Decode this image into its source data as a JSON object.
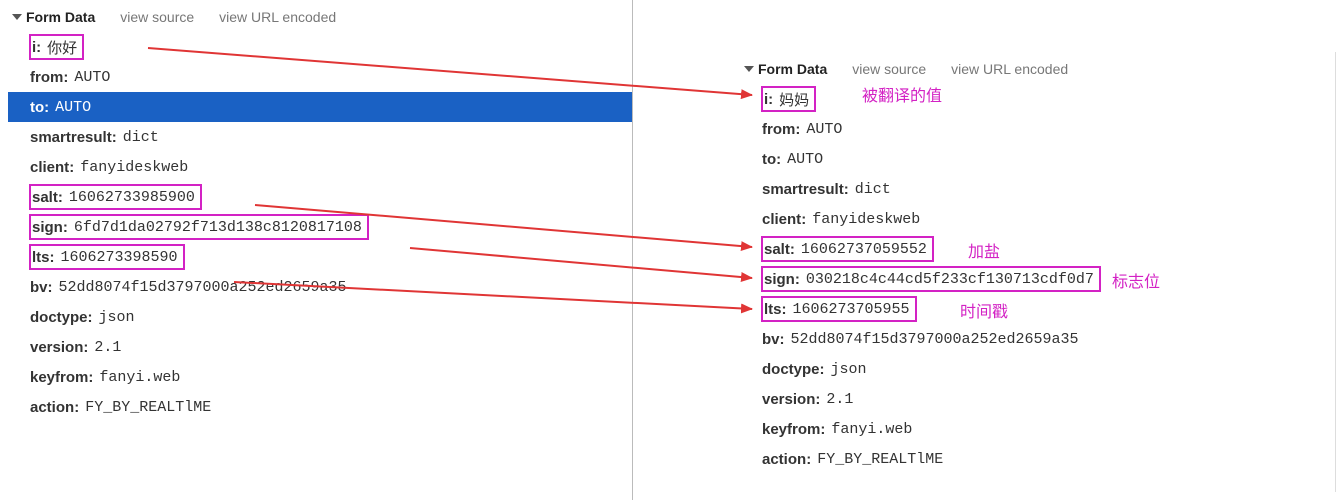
{
  "left": {
    "header": {
      "title": "Form Data",
      "tab_source": "view source",
      "tab_url": "view URL encoded"
    },
    "rows": {
      "i": "你好",
      "from": "AUTO",
      "to": "AUTO",
      "smartresult": "dict",
      "client": "fanyideskweb",
      "salt": "16062733985900",
      "sign": "6fd7d1da02792f713d138c8120817108",
      "lts": "1606273398590",
      "bv": "52dd8074f15d3797000a252ed2659a35",
      "doctype": "json",
      "version": "2.1",
      "keyfrom": "fanyi.web",
      "action": "FY_BY_REALTlME"
    }
  },
  "right": {
    "header": {
      "title": "Form Data",
      "tab_source": "view source",
      "tab_url": "view URL encoded"
    },
    "rows": {
      "i": "妈妈",
      "from": "AUTO",
      "to": "AUTO",
      "smartresult": "dict",
      "client": "fanyideskweb",
      "salt": "16062737059552",
      "sign": "030218c4c44cd5f233cf130713cdf0d7",
      "lts": "1606273705955",
      "bv": "52dd8074f15d3797000a252ed2659a35",
      "doctype": "json",
      "version": "2.1",
      "keyfrom": "fanyi.web",
      "action": "FY_BY_REALTlME"
    }
  },
  "annotations": {
    "a1": "被翻译的值",
    "a2": "加盐",
    "a3": "标志位",
    "a4": "时间戳"
  },
  "labels": {
    "i": "i",
    "from": "from",
    "to": "to",
    "smartresult": "smartresult",
    "client": "client",
    "salt": "salt",
    "sign": "sign",
    "lts": "lts",
    "bv": "bv",
    "doctype": "doctype",
    "version": "version",
    "keyfrom": "keyfrom",
    "action": "action"
  }
}
